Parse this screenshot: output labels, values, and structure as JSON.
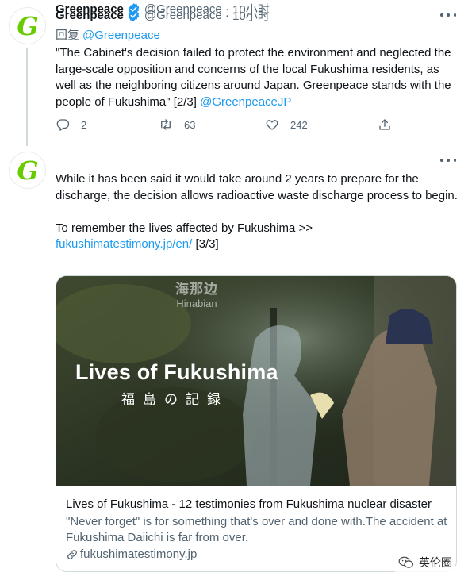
{
  "colors": {
    "accent": "#1d9bf0",
    "text": "#0f1419",
    "muted": "#536471",
    "brand_green": "#66cc00"
  },
  "tweets": [
    {
      "avatar_logo": "G",
      "name": "Greenpeace",
      "handle": "@Greenpeace",
      "time": "10小时",
      "reply_label": "回复",
      "reply_handle": "@Greenpeace",
      "text": "\"The Cabinet's decision failed to protect the environment and neglected the large-scale opposition and concerns of the local Fukushima residents, as well as the neighboring citizens around Japan. Greenpeace stands with the people of Fukushima\" [2/3] ",
      "mention": "@GreenpeaceJP",
      "replies": "2",
      "retweets": "63",
      "likes": "242"
    },
    {
      "avatar_logo": "G",
      "name": "Greenpeace",
      "handle": "@Greenpeace",
      "time": "10小时",
      "text": "While it has been said it would take around 2 years to prepare for the discharge, the decision allows radioactive waste discharge process to begin.\n\nTo remember the lives affected by Fukushima >>\n",
      "link": "fukushimatestimony.jp/en/",
      "link_suffix": " [3/3]",
      "card": {
        "image_title": "Lives of Fukushima",
        "image_subtitle": "福島の記録",
        "image_watermark_cn": "海那边",
        "image_watermark_en": "Hinabian",
        "title": "Lives of Fukushima - 12 testimonies from Fukushima nuclear disaster",
        "description": "\"Never forget\" is for something that's over and done with.The accident at Fukushima Daiichi is far from over.",
        "domain": "fukushimatestimony.jp"
      }
    }
  ],
  "page_watermark": "英伦圈",
  "icons": [
    "verified-badge-icon",
    "more-icon",
    "reply-icon",
    "retweet-icon",
    "like-icon",
    "share-icon",
    "link-icon",
    "wechat-icon"
  ]
}
